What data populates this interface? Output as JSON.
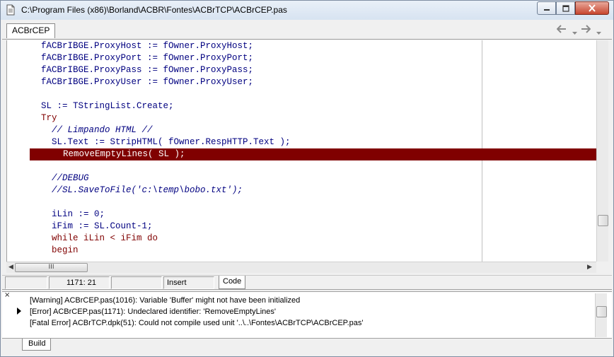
{
  "window": {
    "title": "C:\\Program Files (x86)\\Borland\\ACBR\\Fontes\\ACBrTCP\\ACBrCEP.pas"
  },
  "tabs": {
    "active": "ACBrCEP"
  },
  "editor": {
    "lines": [
      {
        "text": "fACBrIBGE.ProxyHost := fOwner.ProxyHost;",
        "kind": "code"
      },
      {
        "text": "fACBrIBGE.ProxyPort := fOwner.ProxyPort;",
        "kind": "code"
      },
      {
        "text": "fACBrIBGE.ProxyPass := fOwner.ProxyPass;",
        "kind": "code"
      },
      {
        "text": "fACBrIBGE.ProxyUser := fOwner.ProxyUser;",
        "kind": "code"
      },
      {
        "text": "",
        "kind": "code"
      },
      {
        "text": "SL := TStringList.Create;",
        "kind": "code"
      },
      {
        "text": "Try",
        "kind": "keyword"
      },
      {
        "text": "  // Limpando HTML //",
        "kind": "comment"
      },
      {
        "text": "  SL.Text := StripHTML( fOwner.RespHTTP.Text );",
        "kind": "code"
      },
      {
        "text": "  RemoveEmptyLines( SL );",
        "kind": "highlight"
      },
      {
        "text": "",
        "kind": "code"
      },
      {
        "text": "  //DEBUG",
        "kind": "comment"
      },
      {
        "text": "  //SL.SaveToFile('c:\\temp\\bobo.txt');",
        "kind": "comment"
      },
      {
        "text": "",
        "kind": "code"
      },
      {
        "text": "  iLin := 0;",
        "kind": "code"
      },
      {
        "text": "  iFim := SL.Count-1;",
        "kind": "code"
      },
      {
        "text": "  while iLin < iFim do",
        "kind": "keyword"
      },
      {
        "text": "  begin",
        "kind": "keyword"
      }
    ]
  },
  "statusbar": {
    "position": "1171:  21",
    "mode": "Insert",
    "view_tab": "Code"
  },
  "messages": {
    "items": [
      "[Warning] ACBrCEP.pas(1016): Variable 'Buffer' might not have been initialized",
      "[Error] ACBrCEP.pas(1171): Undeclared identifier: 'RemoveEmptyLines'",
      "[Fatal Error] ACBrTCP.dpk(51): Could not compile used unit '..\\..\\Fontes\\ACBrTCP\\ACBrCEP.pas'"
    ],
    "tab": "Build"
  },
  "icons": {
    "close": "×",
    "hthumb": "III"
  }
}
